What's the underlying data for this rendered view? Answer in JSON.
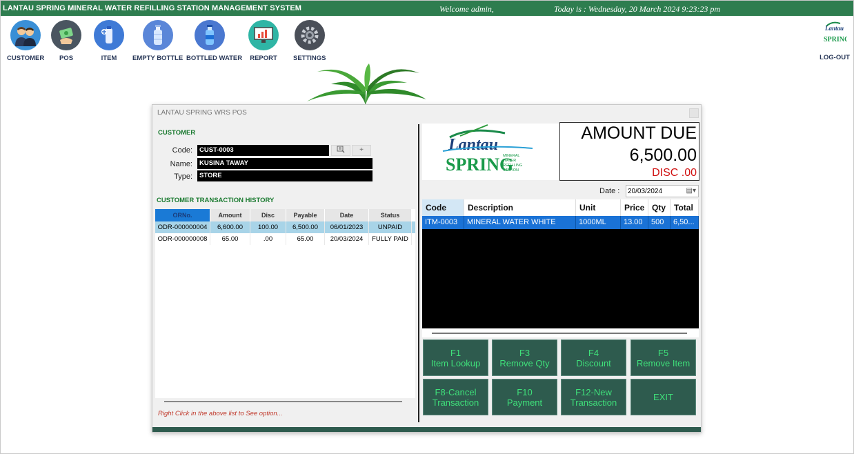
{
  "app": {
    "title": "LANTAU SPRING MINERAL WATER REFILLING STATION MANAGEMENT SYSTEM",
    "welcome": "Welcome admin,",
    "today": "Today is : Wednesday, 20 March 2024 9:23:23 pm"
  },
  "nav": {
    "items": [
      {
        "label": "CUSTOMER",
        "icon": "customer-icon",
        "color": "#3a8fd6"
      },
      {
        "label": "POS",
        "icon": "cash-icon",
        "color": "#4a5560"
      },
      {
        "label": "ITEM",
        "icon": "item-icon",
        "color": "#3f7ad6"
      },
      {
        "label": "EMPTY BOTTLE",
        "icon": "bottle-icon",
        "color": "#5a86d8"
      },
      {
        "label": "BOTTLED WATER",
        "icon": "water-bottle-icon",
        "color": "#4a78d0"
      },
      {
        "label": "REPORT",
        "icon": "report-icon",
        "color": "#2fb5a5"
      },
      {
        "label": "SETTINGS",
        "icon": "gear-icon",
        "color": "#4a4f58"
      }
    ],
    "logout": "LOG-OUT"
  },
  "pos": {
    "window_title": "LANTAU SPRING WRS POS",
    "customer": {
      "section": "CUSTOMER",
      "code_label": "Code:",
      "code": "CUST-0003",
      "name_label": "Name:",
      "name": "KUSINA TAWAY",
      "type_label": "Type:",
      "type": "STORE",
      "add_label": "+"
    },
    "history": {
      "section": "CUSTOMER TRANSACTION HISTORY",
      "columns": [
        "ORNo.",
        "Amount",
        "Disc",
        "Payable",
        "Date",
        "Status"
      ],
      "rows": [
        [
          "ODR-000000004",
          "6,600.00",
          "100.00",
          "6,500.00",
          "06/01/2023",
          "UNPAID"
        ],
        [
          "ODR-000000008",
          "65.00",
          ".00",
          "65.00",
          "20/03/2024",
          "FULLY PAID"
        ]
      ],
      "hint": "Right Click in the above list to See option..."
    },
    "amount": {
      "label": "AMOUNT DUE",
      "value": "6,500.00",
      "disc": "DISC .00"
    },
    "date": {
      "label": "Date :",
      "value": "20/03/2024"
    },
    "items": {
      "columns": [
        "Code",
        "Description",
        "Unit",
        "Price",
        "Qty",
        "Total"
      ],
      "rows": [
        [
          "ITM-0003",
          "MINERAL WATER WHITE",
          "1000ML",
          "13.00",
          "500",
          "6,50..."
        ]
      ]
    },
    "buttons": [
      {
        "key": "F1",
        "label": "Item Lookup"
      },
      {
        "key": "F3",
        "label": "Remove Qty"
      },
      {
        "key": "F4",
        "label": "Discount"
      },
      {
        "key": "F5",
        "label": "Remove Item"
      },
      {
        "key": "F8-Cancel",
        "label": "Transaction"
      },
      {
        "key": "F10",
        "label": "Payment"
      },
      {
        "key": "F12-New",
        "label": "Transaction"
      },
      {
        "key": "EXIT",
        "label": ""
      }
    ]
  },
  "logo": {
    "brand_top": "Lantau",
    "brand_main": "SPRING",
    "brand_sub": [
      "MINERAL",
      "WATER",
      "REFILLING",
      "STATION"
    ]
  }
}
